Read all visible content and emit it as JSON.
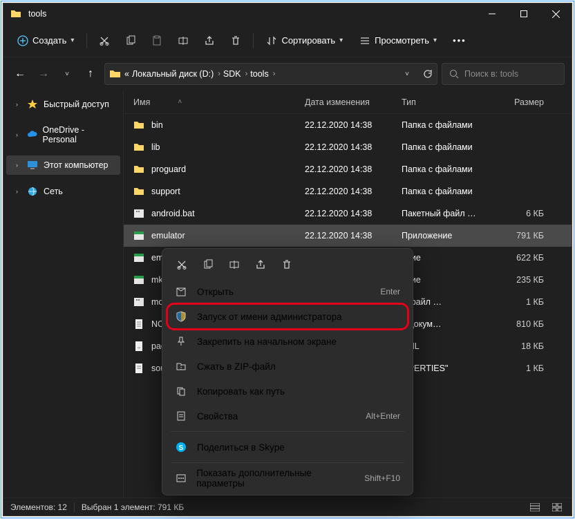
{
  "titlebar": {
    "title": "tools"
  },
  "toolbar": {
    "new_label": "Создать",
    "sort_label": "Сортировать",
    "view_label": "Просмотреть"
  },
  "breadcrumbs": {
    "prefix": "«",
    "items": [
      "Локальный диск (D:)",
      "SDK",
      "tools"
    ]
  },
  "search": {
    "placeholder": "Поиск в: tools"
  },
  "sidebar": {
    "items": [
      {
        "label": "Быстрый доступ",
        "icon": "star"
      },
      {
        "label": "OneDrive - Personal",
        "icon": "cloud"
      },
      {
        "label": "Этот компьютер",
        "icon": "pc",
        "sel": true
      },
      {
        "label": "Сеть",
        "icon": "net"
      }
    ]
  },
  "columns": {
    "name": "Имя",
    "date": "Дата изменения",
    "type": "Тип",
    "size": "Размер"
  },
  "files": [
    {
      "kind": "folder",
      "name": "bin",
      "date": "22.12.2020 14:38",
      "type": "Папка с файлами",
      "size": ""
    },
    {
      "kind": "folder",
      "name": "lib",
      "date": "22.12.2020 14:38",
      "type": "Папка с файлами",
      "size": ""
    },
    {
      "kind": "folder",
      "name": "proguard",
      "date": "22.12.2020 14:38",
      "type": "Папка с файлами",
      "size": ""
    },
    {
      "kind": "folder",
      "name": "support",
      "date": "22.12.2020 14:38",
      "type": "Папка с файлами",
      "size": ""
    },
    {
      "kind": "bat",
      "name": "android.bat",
      "date": "22.12.2020 14:38",
      "type": "Пакетный файл …",
      "size": "6 КБ"
    },
    {
      "kind": "exe",
      "name": "emulator",
      "date": "22.12.2020 14:38",
      "type": "Приложение",
      "size": "791 КБ",
      "sel": true,
      "label_cut": "emulator"
    },
    {
      "kind": "exe",
      "name": "emulator",
      "date": "",
      "type": "ение",
      "size": "622 КБ",
      "label_cut": "emulat"
    },
    {
      "kind": "exe",
      "name": "mksdca",
      "date": "",
      "type": "ение",
      "size": "235 КБ",
      "label_cut": "mksdca"
    },
    {
      "kind": "bat",
      "name": "monitor",
      "date": "",
      "type": "й файл …",
      "size": "1 КБ",
      "label_cut": "monito"
    },
    {
      "kind": "txt",
      "name": "NOTICE.",
      "date": "",
      "type": "й докум…",
      "size": "810 КБ",
      "label_cut": "NOTICE."
    },
    {
      "kind": "xml",
      "name": "package",
      "date": "",
      "type": "XML",
      "size": "18 КБ",
      "label_cut": "package"
    },
    {
      "kind": "prop",
      "name": "source.p",
      "date": "",
      "type": "OPERTIES\"",
      "size": "1 КБ",
      "label_cut": "source.p"
    }
  ],
  "context_menu": {
    "open": "Открыть",
    "open_sc": "Enter",
    "run_admin": "Запуск от имени администратора",
    "pin_start": "Закрепить на начальном экране",
    "zip": "Сжать в ZIP-файл",
    "copy_path": "Копировать как путь",
    "properties": "Свойства",
    "properties_sc": "Alt+Enter",
    "share_skype": "Поделиться в Skype",
    "more": "Показать дополнительные параметры",
    "more_sc": "Shift+F10"
  },
  "status": {
    "count": "Элементов: 12",
    "selection": "Выбран 1 элемент: 791 КБ"
  }
}
